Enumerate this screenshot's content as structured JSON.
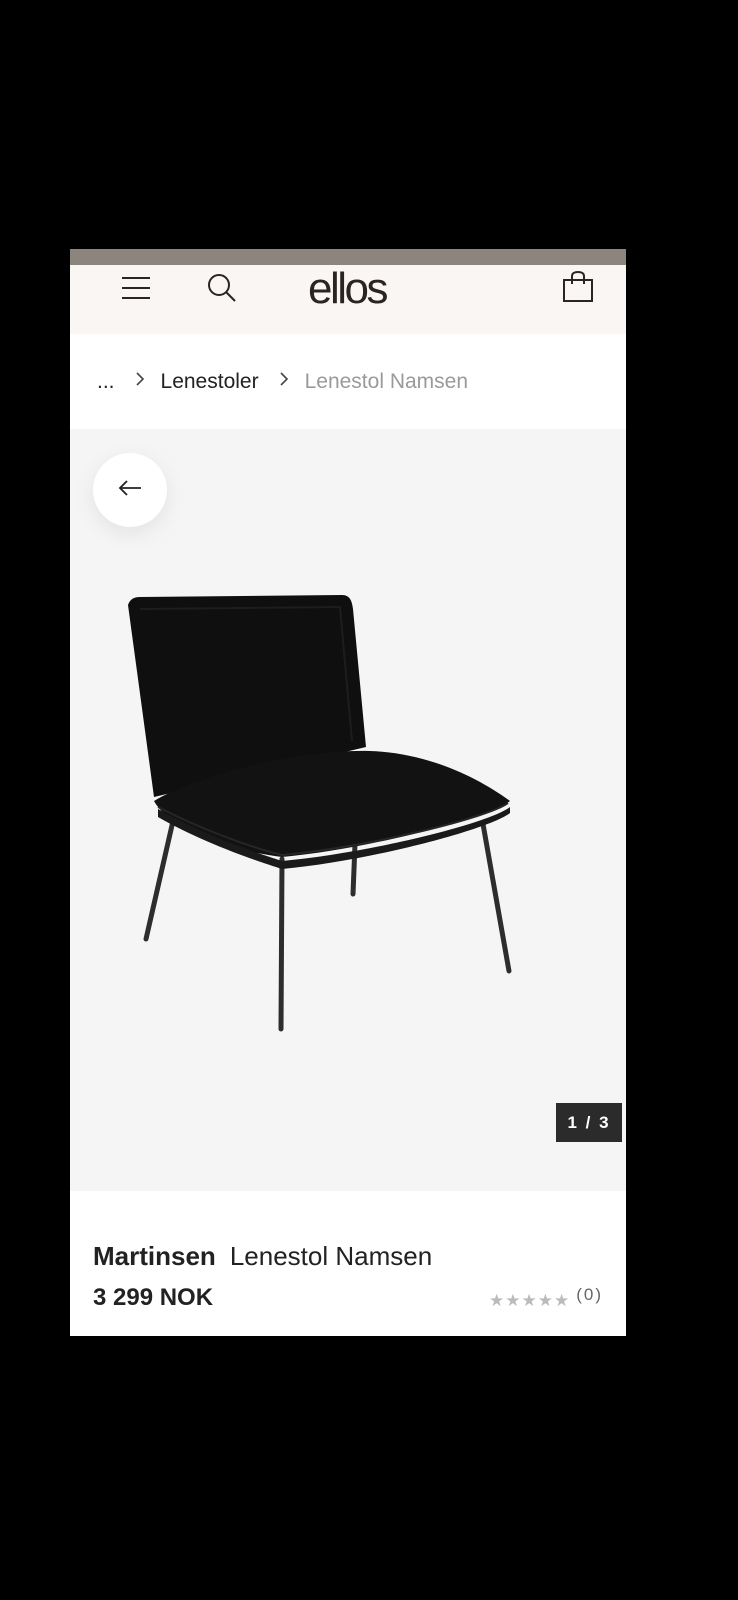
{
  "header": {
    "logo_text": "ellos",
    "menu_icon": "hamburger-menu-icon",
    "search_icon": "search-icon",
    "bag_icon": "shopping-bag-icon"
  },
  "breadcrumb": {
    "ellipsis": "...",
    "items": [
      "Lenestoler"
    ],
    "current": "Lenestol Namsen"
  },
  "gallery": {
    "back_icon": "arrow-left-icon",
    "counter": "1 / 3",
    "image_alt": "black velvet lounge chair with metal legs"
  },
  "product": {
    "brand": "Martinsen",
    "name": "Lenestol Namsen",
    "price": "3 299 NOK",
    "rating_stars": "★★★★★",
    "rating_count": "(0)"
  },
  "colors": {
    "header_bg": "#faf6f3",
    "status_strip": "#8c857e",
    "gallery_bg": "#f5f5f5",
    "counter_bg": "#2b2b2b"
  }
}
